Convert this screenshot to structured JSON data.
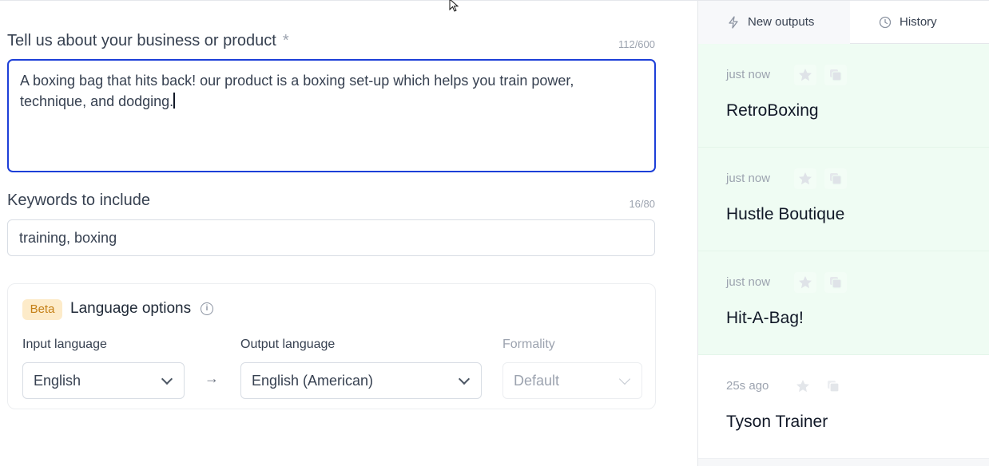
{
  "form": {
    "description": {
      "label": "Tell us about your business or product",
      "required_mark": "*",
      "counter": "112/600",
      "value": "A boxing bag that hits back! our product is a boxing set-up which helps you train power, technique, and dodging."
    },
    "keywords": {
      "label": "Keywords to include",
      "counter": "16/80",
      "value": "training, boxing"
    },
    "language_options": {
      "badge": "Beta",
      "title": "Language options",
      "info_icon": "info-icon",
      "input_language": {
        "label": "Input language",
        "value": "English"
      },
      "arrow": "→",
      "output_language": {
        "label": "Output language",
        "value": "English (American)"
      },
      "formality": {
        "label": "Formality",
        "value": "Default",
        "disabled": true
      }
    }
  },
  "sidebar": {
    "tabs": [
      {
        "label": "New outputs",
        "icon": "lightning-icon",
        "active": true
      },
      {
        "label": "History",
        "icon": "clock-icon",
        "active": false
      }
    ],
    "outputs": [
      {
        "time": "just now",
        "title": "RetroBoxing",
        "new": true
      },
      {
        "time": "just now",
        "title": "Hustle Boutique",
        "new": true
      },
      {
        "time": "just now",
        "title": "Hit-A-Bag!",
        "new": true
      },
      {
        "time": "25s ago",
        "title": "Tyson Trainer",
        "new": false
      }
    ]
  },
  "colors": {
    "focus_border": "#1d3fd8",
    "new_output_bg": "#effcf3",
    "beta_bg": "#fdebc9",
    "beta_text": "#c47f16"
  }
}
